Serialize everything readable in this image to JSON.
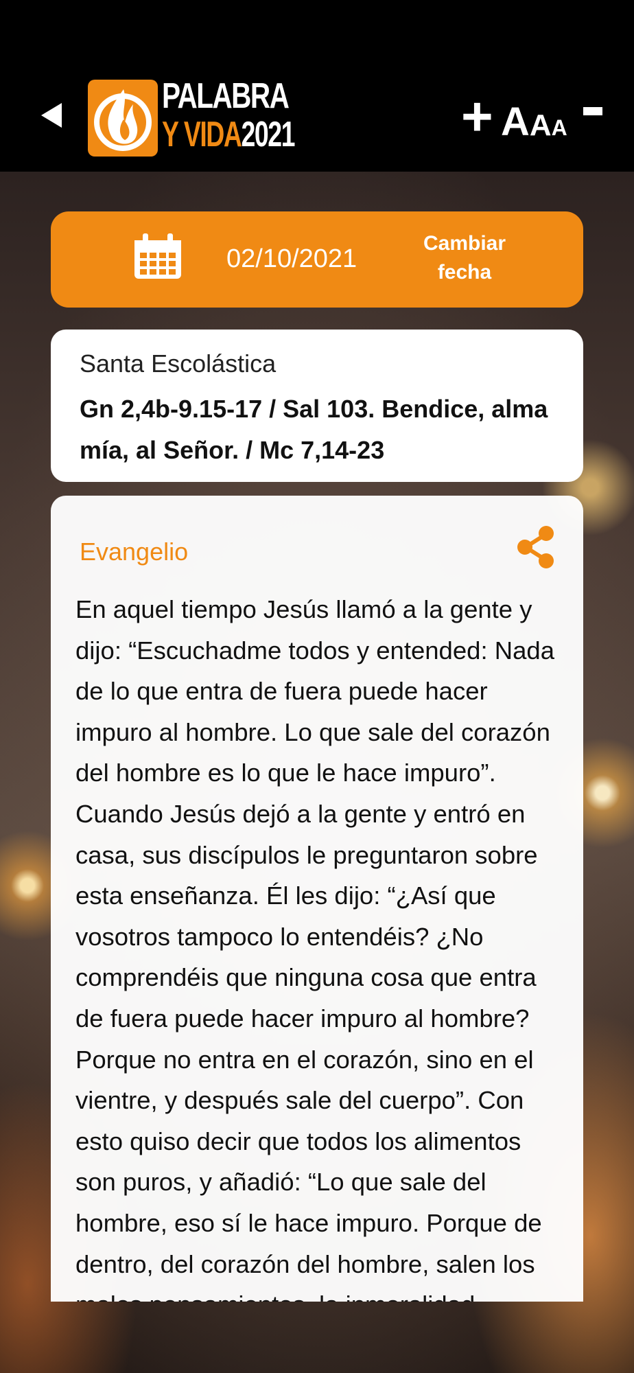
{
  "header": {
    "back_icon": "back-triangle-icon",
    "logo": {
      "line1": "PALABRA",
      "line2_a": "Y VIDA",
      "line2_b": "2021",
      "icon": "flame-icon"
    },
    "font_controls": {
      "increase": "+",
      "sample_large": "A",
      "sample_medium": "A",
      "sample_small": "A",
      "decrease": "-"
    }
  },
  "date_bar": {
    "calendar_icon": "calendar-icon",
    "date": "02/10/2021",
    "change_label": "Cambiar fecha"
  },
  "saint": {
    "name": "Santa Escolástica",
    "readings": "Gn 2,4b-9.15-17 / Sal 103. Bendice, alma mía, al Señor. / Mc 7,14-23"
  },
  "gospel": {
    "title": "Evangelio",
    "share_icon": "share-icon",
    "text": "En aquel tiempo Jesús llamó a la gente y dijo: “Escuchadme todos y entended: Nada de lo que entra de fuera puede hacer impuro al hombre. Lo que sale del corazón del hombre es lo que le hace impuro”. Cuando Jesús dejó a la gente y entró en casa, sus discípulos le preguntaron sobre esta enseñanza. Él les dijo: “¿Así que vosotros tampoco lo entendéis? ¿No comprendéis que ninguna cosa que entra de fuera puede hacer impuro al hombre? Porque no entra en el corazón, sino en el vientre, y después sale del cuerpo”. Con esto quiso decir que todos los alimentos son puros, y añadió: “Lo que sale del hombre, eso sí le hace impuro. Porque de dentro, del corazón del hombre, salen los malos pensamientos, la inmoralidad"
  },
  "colors": {
    "accent": "#f08a14",
    "card": "#ffffff",
    "header_bg": "#000000"
  }
}
